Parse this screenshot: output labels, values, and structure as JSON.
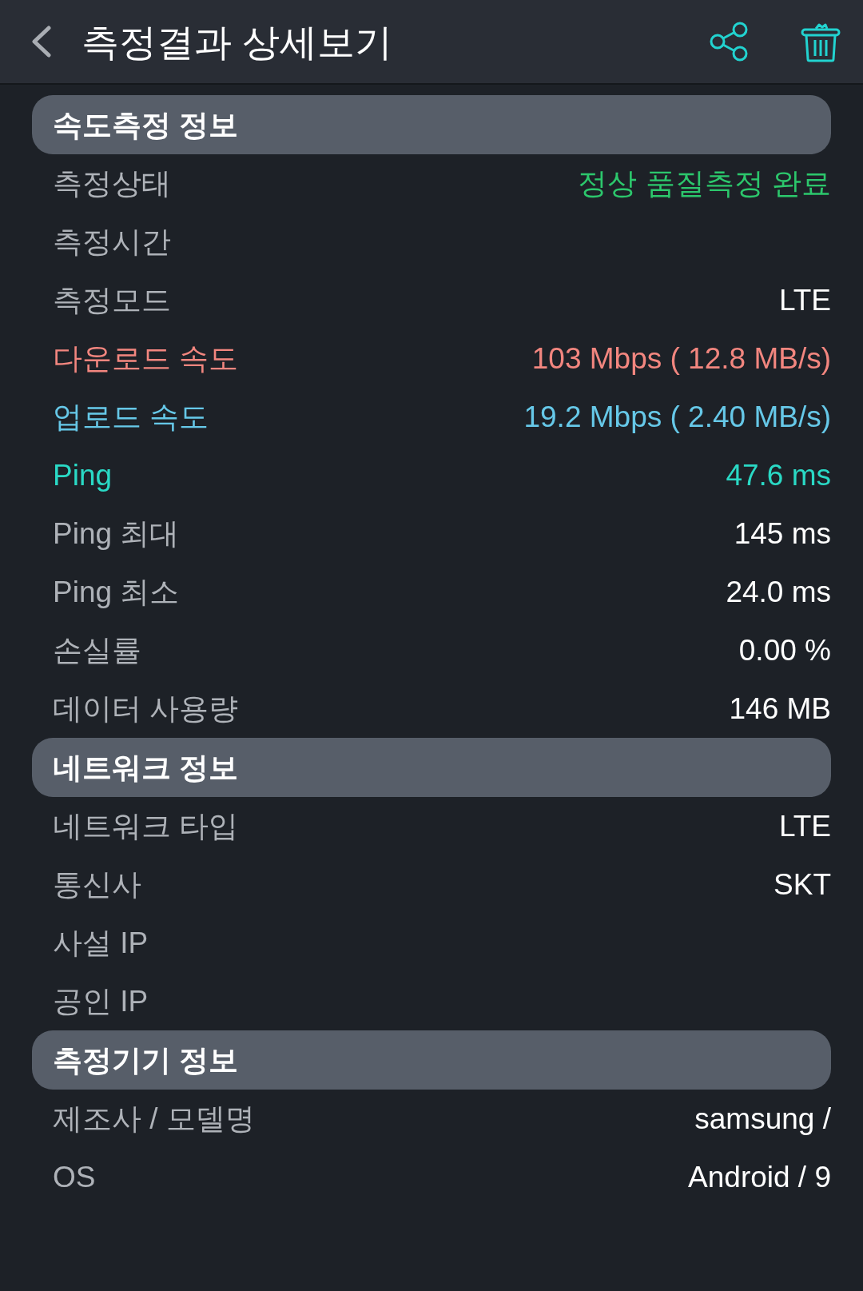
{
  "header": {
    "title": "측정결과 상세보기"
  },
  "sections": [
    {
      "title": "속도측정 정보",
      "rows": [
        {
          "kind": "status",
          "label": "측정상태",
          "value": "정상 품질측정 완료"
        },
        {
          "kind": "plain",
          "label": "측정시간"
        },
        {
          "kind": "plain",
          "label": "측정모드",
          "value": "LTE"
        },
        {
          "kind": "download",
          "label": "다운로드 속도",
          "value": "103 Mbps ( 12.8 MB/s)"
        },
        {
          "kind": "upload",
          "label": "업로드 속도",
          "value": "19.2 Mbps ( 2.40 MB/s)"
        },
        {
          "kind": "ping",
          "label": "Ping",
          "value": "47.6 ms"
        },
        {
          "kind": "plain",
          "label": "Ping 최대",
          "value": "145 ms"
        },
        {
          "kind": "plain",
          "label": "Ping 최소",
          "value": "24.0 ms"
        },
        {
          "kind": "plain",
          "label": "손실률",
          "value": "0.00 %"
        },
        {
          "kind": "plain",
          "label": "데이터 사용량",
          "value": "146 MB"
        }
      ]
    },
    {
      "title": "네트워크 정보",
      "rows": [
        {
          "kind": "plain",
          "label": "네트워크 타입",
          "value": "LTE"
        },
        {
          "kind": "plain",
          "label": "통신사",
          "value": "SKT"
        },
        {
          "kind": "plain",
          "label": "사설 IP"
        },
        {
          "kind": "plain",
          "label": "공인 IP"
        }
      ]
    },
    {
      "title": "측정기기 정보",
      "rows": [
        {
          "kind": "plain",
          "label": "제조사 / 모델명",
          "value": "samsung /"
        },
        {
          "kind": "plain",
          "label": "OS",
          "value": "Android / 9"
        }
      ]
    }
  ]
}
